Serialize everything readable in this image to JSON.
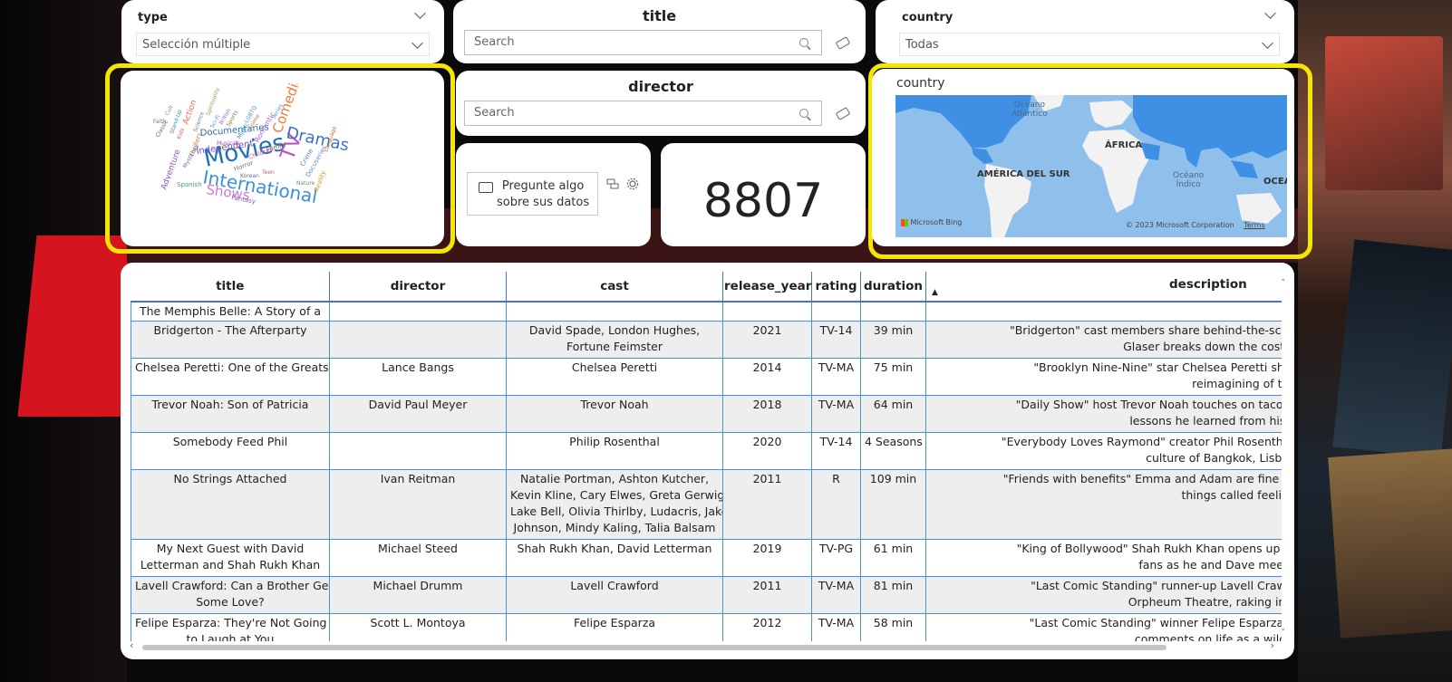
{
  "type_slicer": {
    "title": "type",
    "value": "Selección múltiple"
  },
  "title_search": {
    "title": "title",
    "placeholder": "Search"
  },
  "country_slicer": {
    "title": "country",
    "value": "Todas"
  },
  "director_search": {
    "title": "director",
    "placeholder": "Search"
  },
  "word_cloud": {
    "words": [
      "Movies",
      "International",
      "TV",
      "Dramas",
      "Comedies",
      "Shows",
      "Documentaries",
      "Romantic",
      "Independent",
      "Action",
      "Adventure",
      "Family",
      "Horror",
      "Thrillers",
      "Children",
      "Music",
      "Crime",
      "Docuseries",
      "Spanish",
      "Korean",
      "Reality",
      "Fantasy",
      "Stand-Up",
      "Kids",
      "British",
      "Sci-Fi",
      "Anime",
      "Sports",
      "Musicals",
      "Series",
      "Classic",
      "Cult",
      "Faith",
      "LGBTQ",
      "Language",
      "Spirituality",
      "Science",
      "Nature",
      "Teen",
      "Mysteries"
    ]
  },
  "qa": {
    "text_line1": "Pregunte algo",
    "text_line2": "sobre sus datos"
  },
  "kpi": {
    "value": "8807"
  },
  "map": {
    "title": "country",
    "labels": {
      "atlantic1": "Océano",
      "atlantic2": "Atlántico",
      "africa": "ÁFRICA",
      "south_america": "AMÉRICA DEL SUR",
      "indian1": "Océano",
      "indian2": "Índico",
      "ocean": "OCEAN"
    },
    "attribution": "Microsoft Bing",
    "copyright": "© 2023 Microsoft Corporation",
    "terms": "Terms"
  },
  "table": {
    "headers": [
      "title",
      "director",
      "cast",
      "release_year",
      "rating",
      "duration",
      "description"
    ],
    "rows": [
      {
        "title": [
          "The Memphis Belle: A Story of a"
        ],
        "director": [
          ""
        ],
        "cast": [
          ""
        ],
        "year": "",
        "rating": "",
        "duration": "",
        "desc": [
          ""
        ]
      },
      {
        "title": [
          "Bridgerton - The Afterparty"
        ],
        "director": [
          ""
        ],
        "cast": [
          "David Spade, London Hughes,",
          "Fortune Feimster"
        ],
        "year": "2021",
        "rating": "TV-14",
        "duration": "39 min",
        "desc": [
          "\"Bridgerton\" cast members share behind-the-scenes stories fro",
          "Glaser breaks down the costume drama's s"
        ]
      },
      {
        "title": [
          "Chelsea Peretti: One of the Greats"
        ],
        "director": [
          "Lance Bangs"
        ],
        "cast": [
          "Chelsea Peretti"
        ],
        "year": "2014",
        "rating": "TV-MA",
        "duration": "75 min",
        "desc": [
          "\"Brooklyn Nine-Nine\" star Chelsea Peretti showcases her di",
          "reimagining of the comedy spe"
        ]
      },
      {
        "title": [
          "Trevor Noah: Son of Patricia"
        ],
        "director": [
          "David Paul Meyer"
        ],
        "cast": [
          "Trevor Noah"
        ],
        "year": "2018",
        "rating": "TV-MA",
        "duration": "64 min",
        "desc": [
          "\"Daily Show\" host Trevor Noah touches on tacos, runaway sna",
          "lessons he learned from his mother in this"
        ]
      },
      {
        "title": [
          "Somebody Feed Phil"
        ],
        "director": [
          ""
        ],
        "cast": [
          "Philip Rosenthal"
        ],
        "year": "2020",
        "rating": "TV-14",
        "duration": "4 Seasons",
        "desc": [
          "\"Everybody Loves Raymond\" creator Phil Rosenthal travels the g",
          "culture of Bangkok, Lisbon, Mexico City"
        ]
      },
      {
        "title": [
          "No Strings Attached"
        ],
        "director": [
          "Ivan Reitman"
        ],
        "cast": [
          "Natalie Portman, Ashton Kutcher,",
          "Kevin Kline, Cary Elwes, Greta Gerwig,",
          "Lake Bell, Olivia Thirlby, Ludacris, Jake",
          "Johnson, Mindy Kaling, Talia Balsam"
        ],
        "year": "2011",
        "rating": "R",
        "duration": "109 min",
        "desc": [
          "\"Friends with benefits\" Emma and Adam are fine with their open",
          "things called feelings enter the p"
        ]
      },
      {
        "title": [
          "My Next Guest with David",
          "Letterman and Shah Rukh Khan"
        ],
        "director": [
          "Michael Steed"
        ],
        "cast": [
          "Shah Rukh Khan, David Letterman"
        ],
        "year": "2019",
        "rating": "TV-PG",
        "duration": "61 min",
        "desc": [
          "\"King of Bollywood\" Shah Rukh Khan opens up about his rise t",
          "fans as he and Dave meet up in Mumbai"
        ]
      },
      {
        "title": [
          "Lavell Crawford: Can a Brother Get",
          "Some Love?"
        ],
        "director": [
          "Michael Drumm"
        ],
        "cast": [
          "Lavell Crawford"
        ],
        "year": "2011",
        "rating": "TV-MA",
        "duration": "81 min",
        "desc": [
          "\"Last Comic Standing\" runner-up Lavell Crawford lords over",
          "Orpheum Theatre, raking in the love â€\" a"
        ]
      },
      {
        "title": [
          "Felipe Esparza: They're Not Going",
          "to Laugh at You"
        ],
        "director": [
          "Scott L. Montoya"
        ],
        "cast": [
          "Felipe Esparza"
        ],
        "year": "2012",
        "rating": "TV-MA",
        "duration": "58 min",
        "desc": [
          "\"Last Comic Standing\" winner Felipe Esparza runs riot in his",
          "comments on life as a wild man from Eas"
        ]
      }
    ]
  }
}
